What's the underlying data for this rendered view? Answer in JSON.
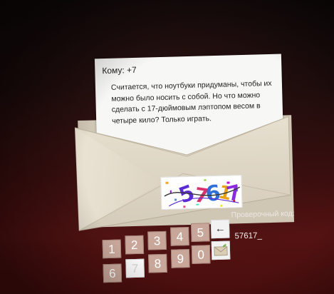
{
  "letter": {
    "to": "Кому: +7",
    "message": "Считается, что ноутбуки придуманы, чтобы их можно было носить с собой. Но что можно сделать с 17-дюймовым лэптопом весом в четыре кило? Только играть."
  },
  "captcha": {
    "digits": "57617",
    "selected_key": "7"
  },
  "keypad": {
    "row1": [
      "1",
      "2",
      "3",
      "4",
      "5"
    ],
    "row2": [
      "6",
      "7",
      "8",
      "9",
      "0"
    ],
    "backspace_icon": "←",
    "send_icon": "envelope-icon"
  },
  "verification": {
    "label": "Проверочный код:",
    "value": "57617_"
  },
  "colors": {
    "key_bg": "#c8a79a",
    "key_selected_bg": "#f6f6f6",
    "background_red": "#551212"
  }
}
